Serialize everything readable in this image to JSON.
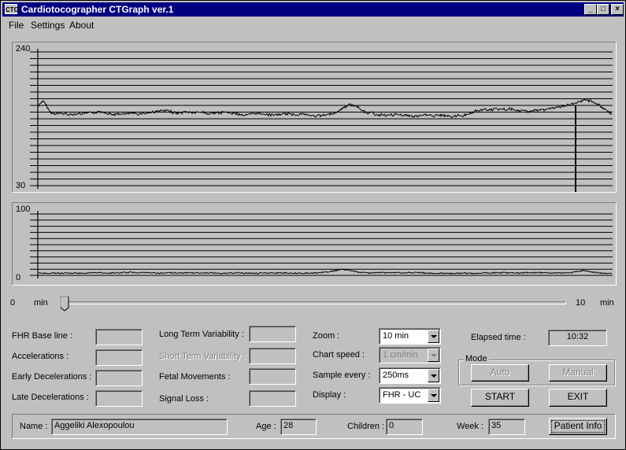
{
  "window": {
    "app_icon_text": "CTG",
    "title": "Cardiotocographer CTGraph ver.1",
    "minimize": "_",
    "maximize": "□",
    "close": "×"
  },
  "menu": {
    "file": "File",
    "settings": "Settings",
    "about": "About"
  },
  "fhr_chart": {
    "ymax_label": "240",
    "ymin_label": "30",
    "line_count": 21
  },
  "uc_chart": {
    "ymax_label": "100",
    "ymin_label": "0",
    "line_count": 11
  },
  "slider": {
    "min_value": "0",
    "min_unit": "min",
    "max_value": "10",
    "max_unit": "min",
    "position_fraction": 0
  },
  "stats": {
    "fhr_baseline": {
      "label": "FHR Base line :",
      "value": ""
    },
    "accelerations": {
      "label": "Accelerations :",
      "value": ""
    },
    "early_decelerations": {
      "label": "Early Decelerations :",
      "value": ""
    },
    "late_decelerations": {
      "label": "Late Decelerations :",
      "value": ""
    },
    "long_term_variability": {
      "label": "Long Term Variability :",
      "value": ""
    },
    "short_term_variability": {
      "label": "Short Term Variability :",
      "value": ""
    },
    "fetal_movements": {
      "label": "Fetal Movements :",
      "value": ""
    },
    "signal_loss": {
      "label": "Signal Loss :",
      "value": ""
    }
  },
  "settings": {
    "zoom": {
      "label": "Zoom :",
      "value": "10 min"
    },
    "chart_speed": {
      "label": "Chart speed :",
      "value": "1 cm/min"
    },
    "sample_every": {
      "label": "Sample every :",
      "value": "250ms"
    },
    "display": {
      "label": "Display :",
      "value": "FHR - UC"
    }
  },
  "elapsed": {
    "label": "Elapsed time :",
    "value": "10:32"
  },
  "mode": {
    "legend": "Mode",
    "auto": "Auto",
    "manual": "Manual"
  },
  "buttons": {
    "start": "START",
    "exit": "EXIT",
    "patient_info": "Patient Info"
  },
  "patient": {
    "name_label": "Name :",
    "name": "Aggeliki Alexopoulou",
    "age_label": "Age :",
    "age": "28",
    "children_label": "Children :",
    "children": "0",
    "week_label": "Week :",
    "week": "35"
  },
  "colors": {
    "title_bar": "#000080",
    "face": "#c0c0c0",
    "trace": "#000000"
  }
}
